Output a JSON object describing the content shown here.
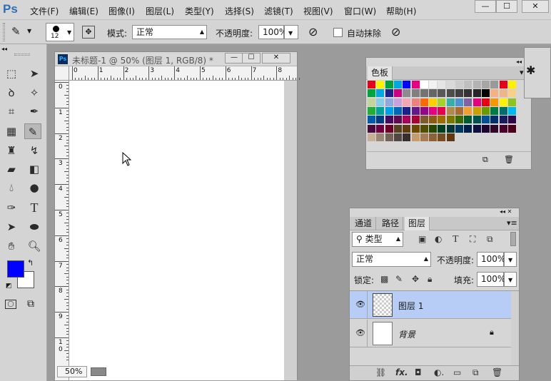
{
  "app": {
    "logo": "Ps"
  },
  "menu": [
    "文件(F)",
    "编辑(E)",
    "图像(I)",
    "图层(L)",
    "类型(Y)",
    "选择(S)",
    "滤镜(T)",
    "视图(V)",
    "窗口(W)",
    "帮助(H)"
  ],
  "window_buttons": [
    "—",
    "☐",
    "✕"
  ],
  "options": {
    "brush_size": "12",
    "mode_label": "模式:",
    "mode_value": "正常",
    "opacity_label": "不透明度:",
    "opacity_value": "100%",
    "auto_erase_label": "自动抹除"
  },
  "document": {
    "title": "未标题-1 @ 50% (图层 1, RGB/8) *",
    "zoom": "50%",
    "ruler_top": [
      "0",
      "1",
      "2",
      "3",
      "4",
      "5",
      "6",
      "7",
      "8"
    ],
    "ruler_left": [
      "0",
      "1",
      "2",
      "3",
      "4",
      "5",
      "6",
      "7",
      "8",
      "9",
      "1\n0"
    ]
  },
  "colors": {
    "foreground": "#0000ff",
    "background": "#ffffff",
    "accent": "#b7cdf5"
  },
  "swatches_panel": {
    "tab": "色板",
    "swatches": [
      "#e5001a",
      "#fff100",
      "#00a23e",
      "#00a7e1",
      "#0000ff",
      "#e4007f",
      "#ffffff",
      "#f2f2f2",
      "#e5e5e5",
      "#d9d9d9",
      "#cccccc",
      "#bfbfbf",
      "#b3b3b3",
      "#a6a6a6",
      "#999999",
      "#e5001a",
      "#fff100",
      "#00a23e",
      "#00a7e1",
      "#1d2088",
      "#c9007f",
      "#8c8c8c",
      "#808080",
      "#737373",
      "#666666",
      "#595959",
      "#4d4d4d",
      "#404040",
      "#333333",
      "#262626",
      "#000000",
      "#f4b183",
      "#ecb68a",
      "#f7d089",
      "#c2d69b",
      "#87cde8",
      "#8ea9db",
      "#c9a0dc",
      "#f4a6b4",
      "#f08080",
      "#ff6a00",
      "#ffd000",
      "#a5d12b",
      "#35b0a9",
      "#4e92d0",
      "#8064a2",
      "#e5007d",
      "#e60012",
      "#f39800",
      "#fff100",
      "#8fc31f",
      "#22ac38",
      "#00a29a",
      "#00a0e9",
      "#0068b7",
      "#1d2088",
      "#601986",
      "#920783",
      "#e4007f",
      "#e5004f",
      "#b28850",
      "#a86b30",
      "#f0a030",
      "#c9a000",
      "#6a9a00",
      "#007b43",
      "#006e6b",
      "#00b7ee",
      "#005aaa",
      "#003b83",
      "#440a5c",
      "#5f0a4e",
      "#a4005b",
      "#a40035",
      "#7c5c2c",
      "#8b5a16",
      "#9c6d00",
      "#7b7800",
      "#3c6a00",
      "#005c2f",
      "#00524e",
      "#005193",
      "#002f6c",
      "#1a1a5e",
      "#2d0845",
      "#470a3c",
      "#6c0041",
      "#6c0027",
      "#564220",
      "#5e3c0f",
      "#6a4a00",
      "#524e00",
      "#274600",
      "#003e1f",
      "#003735",
      "#00385f",
      "#00204b",
      "#101040",
      "#1e0530",
      "#300729",
      "#4a002d",
      "#4a001b",
      "#c7b299",
      "#998675",
      "#736357",
      "#534741",
      "#362f2d",
      "#c69c6d",
      "#a67c52",
      "#8c6239",
      "#754c24",
      "#603913"
    ]
  },
  "layers_panel": {
    "tabs": [
      "通道",
      "路径",
      "图层"
    ],
    "filter_kind": "类型",
    "blend_mode": "正常",
    "opacity_label": "不透明度:",
    "opacity_value": "100%",
    "lock_label": "锁定:",
    "fill_label": "填充:",
    "fill_value": "100%",
    "layers": [
      {
        "name": "图层 1"
      },
      {
        "name": "背景"
      }
    ]
  }
}
